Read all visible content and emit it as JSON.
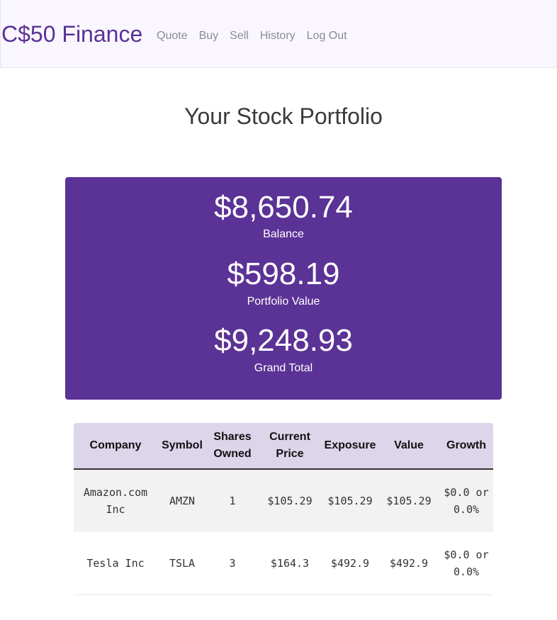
{
  "navbar": {
    "brand": "C$50 Finance",
    "links": [
      "Quote",
      "Buy",
      "Sell",
      "History",
      "Log Out"
    ]
  },
  "page": {
    "title": "Your Stock Portfolio"
  },
  "summary": {
    "balance_value": "$8,650.74",
    "balance_label": "Balance",
    "portfolio_value": "$598.19",
    "portfolio_label": "Portfolio Value",
    "total_value": "$9,248.93",
    "total_label": "Grand Total"
  },
  "table": {
    "headers": [
      "Company",
      "Symbol",
      "Shares Owned",
      "Current Price",
      "Exposure",
      "Value",
      "Growth"
    ],
    "rows": [
      [
        "Amazon.com Inc",
        "AMZN",
        "1",
        "$105.29",
        "$105.29",
        "$105.29",
        "$0.0 or 0.0%"
      ],
      [
        "Tesla Inc",
        "TSLA",
        "3",
        "$164.3",
        "$492.9",
        "$492.9",
        "$0.0 or 0.0%"
      ]
    ]
  },
  "colors": {
    "brand": "#5b3196",
    "summary_bg": "#5b3296",
    "table_header_bg": "#ddd5ea",
    "navbar_bg": "#f9f7fd"
  }
}
